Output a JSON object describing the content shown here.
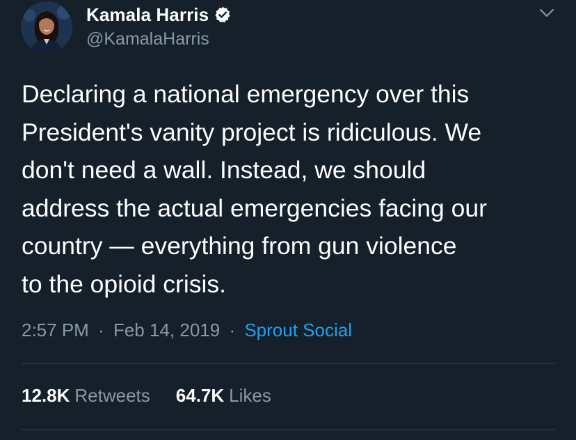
{
  "tweet": {
    "display_name": "Kamala Harris",
    "handle": "@KamalaHarris",
    "text": "Declaring a national emergency over this\nPresident's vanity project is ridiculous. We\ndon't need a wall. Instead, we should\naddress the actual emergencies facing our\ncountry — everything from gun violence\nto the opioid crisis.",
    "time": "2:57 PM",
    "separator": "·",
    "date": "Feb 14, 2019",
    "source": "Sprout Social"
  },
  "stats": {
    "retweets_count": "12.8K",
    "retweets_label": "Retweets",
    "likes_count": "64.7K",
    "likes_label": "Likes"
  },
  "icons": {
    "verified": "verified-badge-icon",
    "caret": "chevron-down-icon"
  },
  "colors": {
    "background": "#15202b",
    "primary_text": "#ffffff",
    "secondary_text": "#8899a6",
    "link": "#1da1f2",
    "divider": "#38444d"
  }
}
